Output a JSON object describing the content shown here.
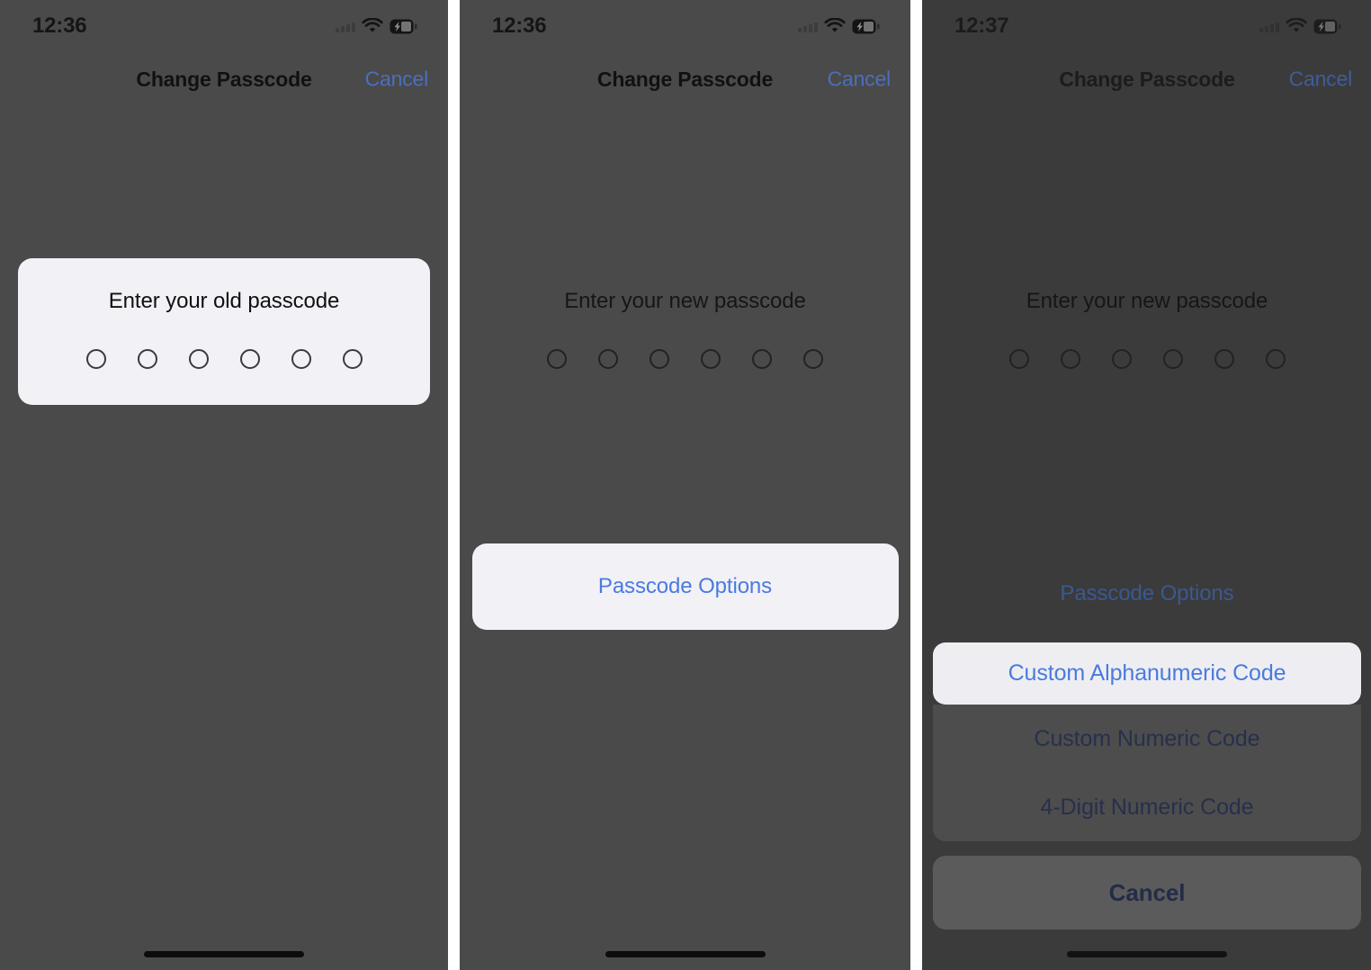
{
  "panels": [
    {
      "status": {
        "time": "12:36",
        "signal_icon": "signal-bars-icon",
        "wifi_icon": "wifi-icon",
        "battery_icon": "battery-charging-icon"
      },
      "nav": {
        "title": "Change Passcode",
        "cancel_label": "Cancel"
      },
      "prompt": {
        "text": "Enter your old passcode",
        "dot_count": 6,
        "highlighted": true
      }
    },
    {
      "status": {
        "time": "12:36",
        "signal_icon": "signal-bars-icon",
        "wifi_icon": "wifi-icon",
        "battery_icon": "battery-charging-icon"
      },
      "nav": {
        "title": "Change Passcode",
        "cancel_label": "Cancel"
      },
      "prompt": {
        "text": "Enter your new passcode",
        "dot_count": 6,
        "highlighted": false
      },
      "options_button": {
        "label": "Passcode Options",
        "highlighted": true
      }
    },
    {
      "status": {
        "time": "12:37",
        "signal_icon": "signal-bars-icon",
        "wifi_icon": "wifi-icon",
        "battery_icon": "battery-charging-icon"
      },
      "nav": {
        "title": "Change Passcode",
        "cancel_label": "Cancel"
      },
      "prompt": {
        "text": "Enter your new passcode",
        "dot_count": 6,
        "highlighted": false
      },
      "options_button": {
        "label": "Passcode Options",
        "highlighted": false
      },
      "action_sheet": {
        "items": [
          {
            "label": "Custom Alphanumeric Code",
            "highlighted": true
          },
          {
            "label": "Custom Numeric Code",
            "highlighted": false
          },
          {
            "label": "4-Digit Numeric Code",
            "highlighted": false
          }
        ],
        "cancel_label": "Cancel"
      }
    }
  ],
  "colors": {
    "screen_background": "#4a4a4a",
    "screen_background_dimmed": "#3b3b3b",
    "highlight_surface": "#f1f1f6",
    "accent_blue": "#4a7ae0",
    "nav_link_blue": "#4a6fbd",
    "sheet_surface": "#4d4d4d",
    "sheet_cancel_surface": "#5b5b5b"
  }
}
